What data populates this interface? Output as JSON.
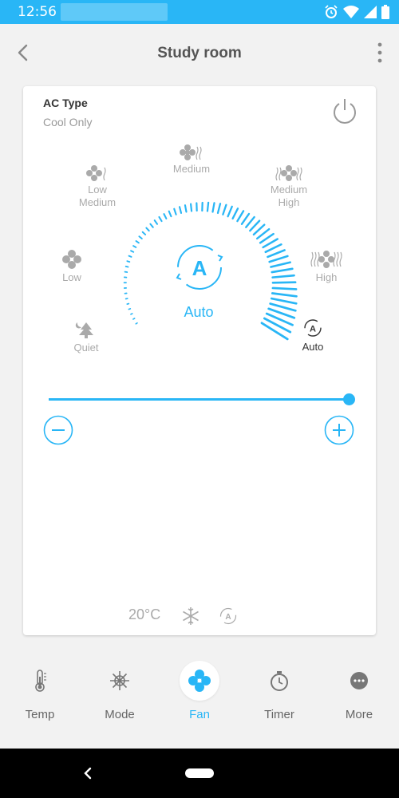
{
  "status_bar": {
    "time": "12:56",
    "icons": [
      "alarm-icon",
      "wifi-icon",
      "signal-icon",
      "battery-icon"
    ]
  },
  "header": {
    "title": "Study room"
  },
  "card": {
    "ac_type_label": "AC Type",
    "ac_type_value": "Cool Only",
    "speeds": {
      "medium": "Medium",
      "low_medium_1": "Low",
      "low_medium_2": "Medium",
      "medium_high_1": "Medium",
      "medium_high_2": "High",
      "low": "Low",
      "high": "High",
      "quiet": "Quiet",
      "auto": "Auto"
    },
    "dial": {
      "mode_letter": "A",
      "current_label": "Auto"
    },
    "slider": {
      "value_fraction": 1.0
    },
    "summary": {
      "temperature": "20°C",
      "icons": [
        "snowflake-icon",
        "auto-fan-icon"
      ]
    }
  },
  "tabs": [
    {
      "label": "Temp",
      "icon": "thermometer-icon",
      "active": false
    },
    {
      "label": "Mode",
      "icon": "mode-icon",
      "active": false
    },
    {
      "label": "Fan",
      "icon": "fan-icon",
      "active": true
    },
    {
      "label": "Timer",
      "icon": "timer-icon",
      "active": false
    },
    {
      "label": "More",
      "icon": "more-icon",
      "active": false
    }
  ],
  "colors": {
    "accent": "#29b6f6",
    "muted": "#aaaaaa"
  }
}
